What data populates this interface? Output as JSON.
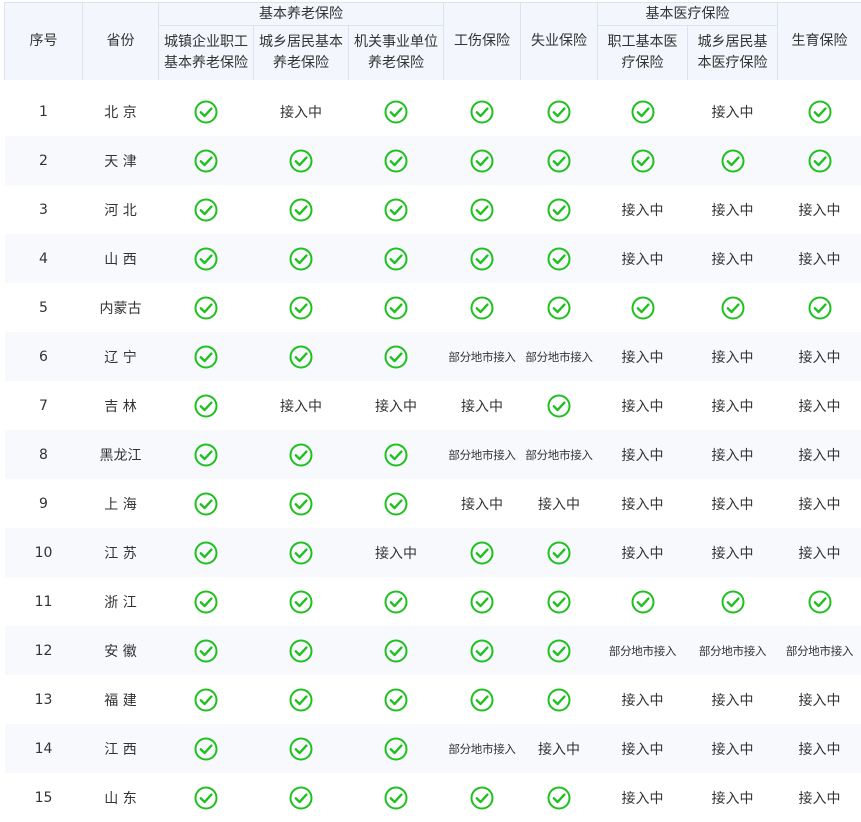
{
  "header": {
    "group_pension": "基本养老保险",
    "group_medical": "基本医疗保险",
    "col_index": "序号",
    "col_province": "省份",
    "col_urban_enterprise_pension": "城镇企业职工基本养老保险",
    "col_urban_rural_pension": "城乡居民基本养老保险",
    "col_institution_pension": "机关事业单位养老保险",
    "col_injury": "工伤保险",
    "col_unemployment": "失业保险",
    "col_employee_medical": "职工基本医疗保险",
    "col_resident_medical": "城乡居民基本医疗保险",
    "col_maternity": "生育保险"
  },
  "status_labels": {
    "pending": "接入中",
    "partial": "部分地市接入"
  },
  "colors": {
    "check_green": "#1fc01f",
    "header_bg": "#f3f6fc",
    "row_alt_bg": "#f7f9fd",
    "text": "#333333"
  },
  "icons": {
    "connected": "check-circle-icon"
  },
  "rows": [
    {
      "index": "1",
      "province": "北 京",
      "cells": [
        "ok",
        "pending",
        "ok",
        "ok",
        "ok",
        "ok",
        "pending",
        "ok"
      ]
    },
    {
      "index": "2",
      "province": "天 津",
      "cells": [
        "ok",
        "ok",
        "ok",
        "ok",
        "ok",
        "ok",
        "ok",
        "ok"
      ]
    },
    {
      "index": "3",
      "province": "河 北",
      "cells": [
        "ok",
        "ok",
        "ok",
        "ok",
        "ok",
        "pending",
        "pending",
        "pending"
      ]
    },
    {
      "index": "4",
      "province": "山 西",
      "cells": [
        "ok",
        "ok",
        "ok",
        "ok",
        "ok",
        "pending",
        "pending",
        "pending"
      ]
    },
    {
      "index": "5",
      "province": "内蒙古",
      "cells": [
        "ok",
        "ok",
        "ok",
        "ok",
        "ok",
        "ok",
        "ok",
        "ok"
      ]
    },
    {
      "index": "6",
      "province": "辽 宁",
      "cells": [
        "ok",
        "ok",
        "ok",
        "partial",
        "partial",
        "pending",
        "pending",
        "pending"
      ]
    },
    {
      "index": "7",
      "province": "吉 林",
      "cells": [
        "ok",
        "pending",
        "pending",
        "pending",
        "ok",
        "pending",
        "pending",
        "pending"
      ]
    },
    {
      "index": "8",
      "province": "黑龙江",
      "cells": [
        "ok",
        "ok",
        "ok",
        "partial",
        "partial",
        "pending",
        "pending",
        "pending"
      ]
    },
    {
      "index": "9",
      "province": "上 海",
      "cells": [
        "ok",
        "ok",
        "ok",
        "pending",
        "pending",
        "pending",
        "pending",
        "pending"
      ]
    },
    {
      "index": "10",
      "province": "江 苏",
      "cells": [
        "ok",
        "ok",
        "pending",
        "ok",
        "ok",
        "pending",
        "pending",
        "pending"
      ]
    },
    {
      "index": "11",
      "province": "浙 江",
      "cells": [
        "ok",
        "ok",
        "ok",
        "ok",
        "ok",
        "ok",
        "ok",
        "ok"
      ]
    },
    {
      "index": "12",
      "province": "安 徽",
      "cells": [
        "ok",
        "ok",
        "ok",
        "ok",
        "ok",
        "partial",
        "partial",
        "partial"
      ]
    },
    {
      "index": "13",
      "province": "福 建",
      "cells": [
        "ok",
        "ok",
        "ok",
        "ok",
        "ok",
        "pending",
        "pending",
        "pending"
      ]
    },
    {
      "index": "14",
      "province": "江 西",
      "cells": [
        "ok",
        "ok",
        "ok",
        "partial",
        "pending",
        "pending",
        "pending",
        "pending"
      ]
    },
    {
      "index": "15",
      "province": "山 东",
      "cells": [
        "ok",
        "ok",
        "ok",
        "ok",
        "ok",
        "pending",
        "pending",
        "pending"
      ]
    }
  ]
}
